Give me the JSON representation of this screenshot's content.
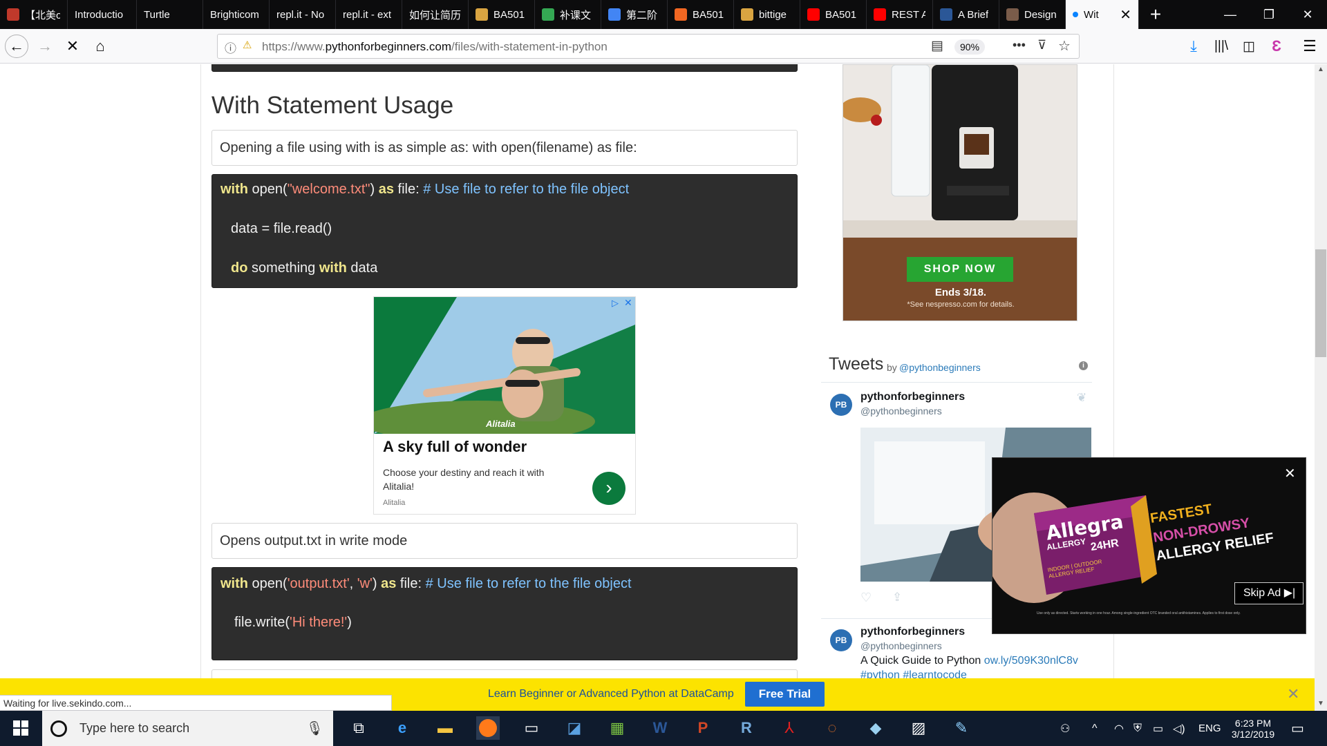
{
  "browser": {
    "tabs": [
      {
        "label": "【北美offe",
        "fav": "#c0392b"
      },
      {
        "label": "Introductio",
        "fav": ""
      },
      {
        "label": "Turtle",
        "fav": ""
      },
      {
        "label": "Brighticom",
        "fav": ""
      },
      {
        "label": "repl.it - No",
        "fav": ""
      },
      {
        "label": "repl.it - ext",
        "fav": ""
      },
      {
        "label": "如何让简历",
        "fav": ""
      },
      {
        "label": "BA501",
        "fav": "#d9a441"
      },
      {
        "label": "补课文",
        "fav": "#34a853"
      },
      {
        "label": "第二阶",
        "fav": "#4285f4"
      },
      {
        "label": "BA501",
        "fav": "#f26722"
      },
      {
        "label": "bittige",
        "fav": "#d9a441"
      },
      {
        "label": "BA501",
        "fav": "#ff0000"
      },
      {
        "label": "REST A",
        "fav": "#ff0000"
      },
      {
        "label": "A Brief",
        "fav": "#2b5797"
      },
      {
        "label": "Design",
        "fav": "#7a5c4a"
      }
    ],
    "active_tab": {
      "label": "Wit"
    },
    "url_prefix": "https://www.",
    "url_domain": "pythonforbeginners.com",
    "url_path": "/files/with-statement-in-python",
    "zoom": "90%",
    "status": "Waiting for live.sekindo.com..."
  },
  "article": {
    "heading": "With Statement Usage",
    "intro": "Opening a file using with is as simple as: with open(filename) as file:",
    "code1": {
      "line1": {
        "kw1": "with",
        "t1": " open(",
        "s1": "\"welcome.txt\"",
        "t2": ") ",
        "kw2": "as",
        "t3": " file: ",
        "cm": "# Use file to refer to the file object"
      },
      "line2": "data = file.read()",
      "line3": {
        "kw1": "do",
        "t1": " something ",
        "kw2": "with",
        "t2": " data"
      }
    },
    "mid_text": "Opens output.txt in write mode",
    "code2": {
      "line1": {
        "kw1": "with",
        "t1": " open(",
        "s1": "'output.txt'",
        "t2": ", ",
        "s2": "'w'",
        "t3": ") ",
        "kw2": "as",
        "t4": " file:  ",
        "cm": "# Use file to refer to the file object"
      },
      "line2": {
        "t1": "file.write(",
        "s1": "'Hi there!'",
        "t2": ")"
      }
    }
  },
  "ad_alitalia": {
    "headline": "A sky full of wonder",
    "body": "Choose your destiny and reach it with Alitalia!",
    "source": "Alitalia",
    "brand_mark": "Alitalia"
  },
  "sidebar_ad": {
    "cta": "SHOP NOW",
    "ends": "Ends 3/18.",
    "fine": "*See nespresso.com for details."
  },
  "tweets": {
    "title": "Tweets",
    "by": "by",
    "handle_link": "@pythonbeginners",
    "items": [
      {
        "name": "pythonforbeginners",
        "handle": "@pythonbeginners"
      },
      {
        "name": "pythonforbeginners",
        "handle": "@pythonbeginners",
        "text": "A Quick Guide to Python ",
        "link": "ow.ly/509K30nlC8v",
        "tags": "#python #learntocode"
      }
    ],
    "avatar_text": "PB"
  },
  "video_ad": {
    "brand": "Allegra",
    "sub": "ALLERGY",
    "hours": "24HR",
    "box_small": "INDOOR | OUTDOOR ALLERGY RELIEF",
    "tagline1": "FASTEST",
    "tagline2": "NON-DROWSY",
    "tagline3": "ALLERGY RELIEF",
    "skip": "Skip Ad",
    "fine": "Use only as directed. Starts working in one hour. Among single-ingredient OTC branded oral antihistamines. Applies to first dose only."
  },
  "datacamp": {
    "text": "Learn Beginner or Advanced Python at DataCamp",
    "button": "Free Trial"
  },
  "taskbar": {
    "search_placeholder": "Type here to search",
    "lang": "ENG",
    "time": "6:23 PM",
    "date": "3/12/2019"
  },
  "colors": {
    "tab_bg": "#0c0c0d",
    "banner": "#fce300",
    "cta_green": "#27a532",
    "code_bg": "#2d2d2d",
    "alitalia_green": "#0b7a3d"
  }
}
